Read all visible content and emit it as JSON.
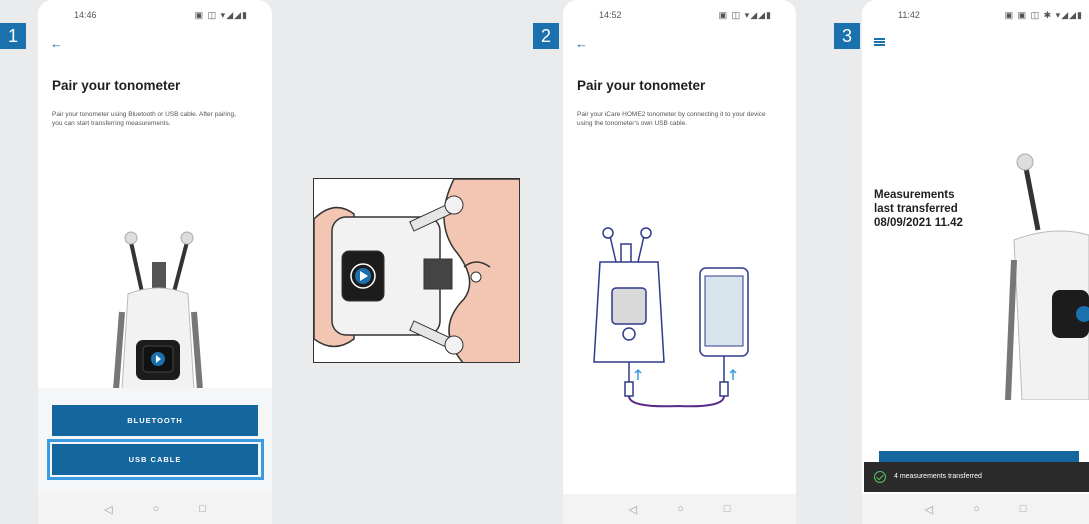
{
  "badges": [
    "1",
    "2",
    "3"
  ],
  "screen1": {
    "time": "14:46",
    "status_icons": "▣ ◫ ▾◢◢▮",
    "title": "Pair your tonometer",
    "description": "Pair your tonometer using Bluetooth or USB cable. After pairing, you can start transferring measurements.",
    "bluetooth_label": "BLUETOOTH",
    "usb_label": "USB CABLE"
  },
  "screen2": {
    "time": "14:52",
    "status_icons": "▣ ◫ ▾◢◢▮",
    "title": "Pair your tonometer",
    "description": "Pair your iCare HOME2 tonometer by connecting it to your device using the tonometer's own USB cable."
  },
  "screen3": {
    "time": "11:42",
    "status_icons": "▣ ▣ ◫ ✱ ▾◢◢▮",
    "measure_line1": "Measurements",
    "measure_line2": "last transferred",
    "measure_line3": "08/09/2021 11.42",
    "toast": "4 measurements transferred"
  },
  "nav": {
    "back": "◁",
    "home": "○",
    "recent": "□"
  },
  "colors": {
    "brand": "#1a71ad",
    "button": "#15669e",
    "highlight": "#3b9be0",
    "background": "#eaebec"
  }
}
